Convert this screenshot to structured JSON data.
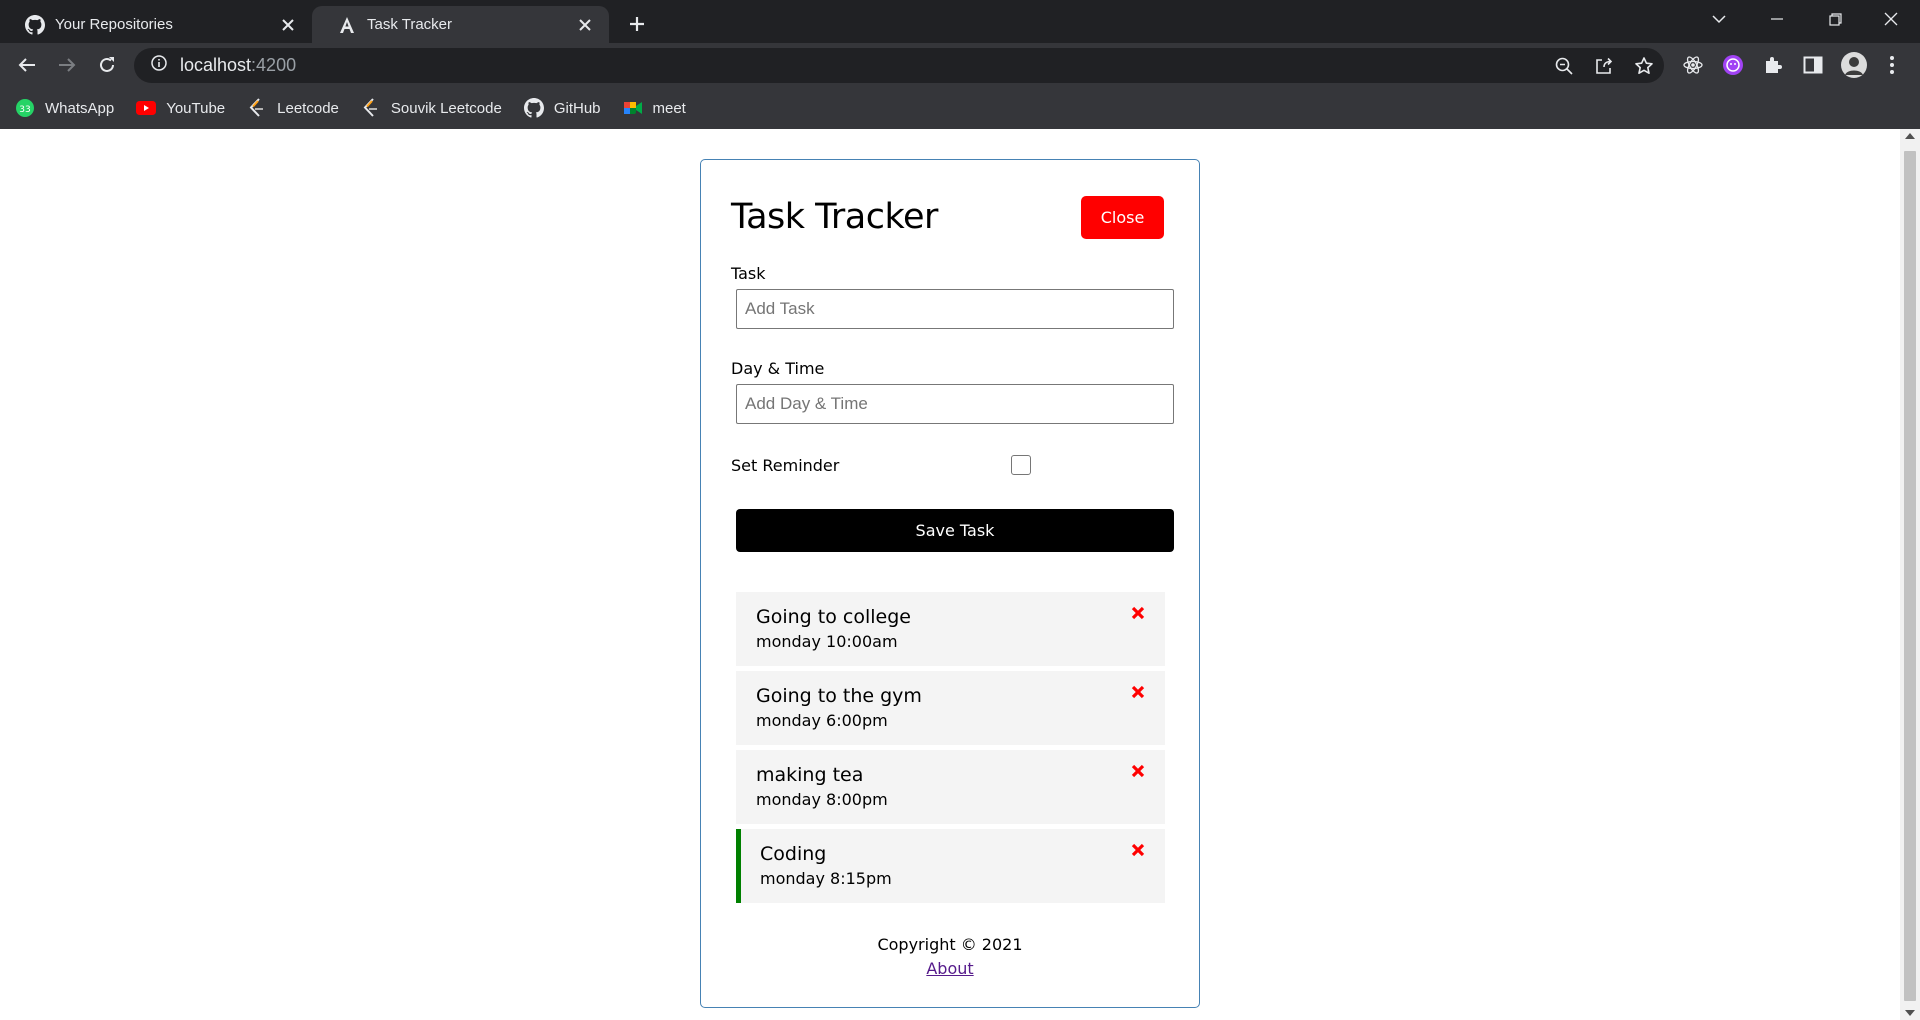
{
  "browser": {
    "tabs": [
      {
        "title": "Your Repositories",
        "icon": "github-icon"
      },
      {
        "title": "Task Tracker",
        "icon": "angular-icon"
      }
    ],
    "url_host": "localhost",
    "url_port": ":4200",
    "bookmarks": [
      {
        "label": "WhatsApp",
        "icon": "whatsapp-icon"
      },
      {
        "label": "YouTube",
        "icon": "youtube-icon"
      },
      {
        "label": "Leetcode",
        "icon": "leetcode-icon"
      },
      {
        "label": "Souvik Leetcode",
        "icon": "leetcode-icon"
      },
      {
        "label": "GitHub",
        "icon": "github-icon"
      },
      {
        "label": "meet",
        "icon": "meet-icon"
      }
    ]
  },
  "app": {
    "title": "Task Tracker",
    "close_label": "Close",
    "form": {
      "task_label": "Task",
      "task_placeholder": "Add Task",
      "day_label": "Day & Time",
      "day_placeholder": "Add Day & Time",
      "reminder_label": "Set Reminder",
      "reminder_checked": false,
      "save_label": "Save Task"
    },
    "tasks": [
      {
        "text": "Going to college",
        "day": "monday 10:00am",
        "reminder": false
      },
      {
        "text": "Going to the gym",
        "day": "monday 6:00pm",
        "reminder": false
      },
      {
        "text": "making tea",
        "day": "monday 8:00pm",
        "reminder": false
      },
      {
        "text": "Coding",
        "day": "monday 8:15pm",
        "reminder": true
      }
    ],
    "footer": {
      "copyright": "Copyright © 2021",
      "about_link": "About"
    }
  },
  "colors": {
    "close_button": "#ff0000",
    "save_button": "#000000",
    "reminder_border": "#008000",
    "delete_icon": "#ff0000",
    "container_border": "#4682b4"
  }
}
